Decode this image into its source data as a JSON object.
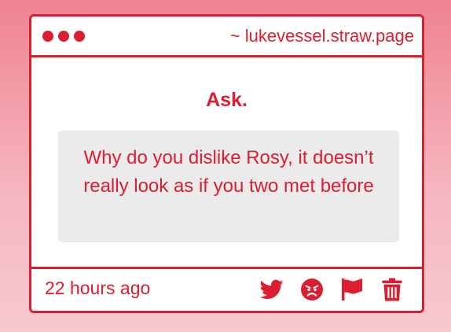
{
  "window": {
    "url": "~ lukevessel.straw.page"
  },
  "main": {
    "heading": "Ask.",
    "question": "Why do you dislike Rosy, it doesn’t really look as if you two met before"
  },
  "footer": {
    "timestamp": "22 hours ago",
    "actions": [
      {
        "icon": "twitter-icon"
      },
      {
        "icon": "angry-face-icon"
      },
      {
        "icon": "flag-icon"
      },
      {
        "icon": "trash-icon"
      }
    ]
  },
  "colors": {
    "accent": "#dc1e31",
    "background_top": "#ef8391",
    "background_bottom": "#f7c8cf",
    "question_box": "#ecebec"
  }
}
